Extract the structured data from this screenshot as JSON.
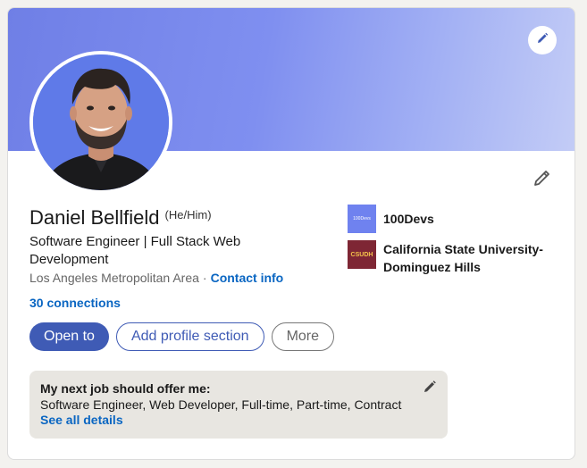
{
  "profile": {
    "name": "Daniel Bellfield",
    "pronouns": "(He/Him)",
    "headline": "Software Engineer | Full Stack Web Development",
    "location": "Los Angeles Metropolitan Area",
    "location_separator": "·",
    "contact_info_label": "Contact info",
    "connections_label": "30 connections"
  },
  "actions": {
    "open_to_label": "Open to",
    "add_section_label": "Add profile section",
    "more_label": "More"
  },
  "orgs": [
    {
      "name": "100Devs",
      "logo_text": "100Devs",
      "icon": "100devs-logo"
    },
    {
      "name": "California State University-Dominguez Hills",
      "logo_text": "CSUDH",
      "icon": "csudh-logo"
    }
  ],
  "open_to_work": {
    "title": "My next job should offer me:",
    "details": "Software Engineer, Web Developer, Full-time, Part-time, Contract",
    "link_label": "See all details"
  },
  "icons": {
    "banner_edit": "pencil-icon",
    "intro_edit": "pencil-icon",
    "otw_edit": "pencil-icon"
  },
  "colors": {
    "accent": "#0a66c2",
    "primary_button": "#3f5bb5",
    "banner_start": "#6f7fe6",
    "banner_end": "#c3ccf6",
    "otw_background": "#e8e6e1",
    "csudh_logo": "#7e2634"
  }
}
